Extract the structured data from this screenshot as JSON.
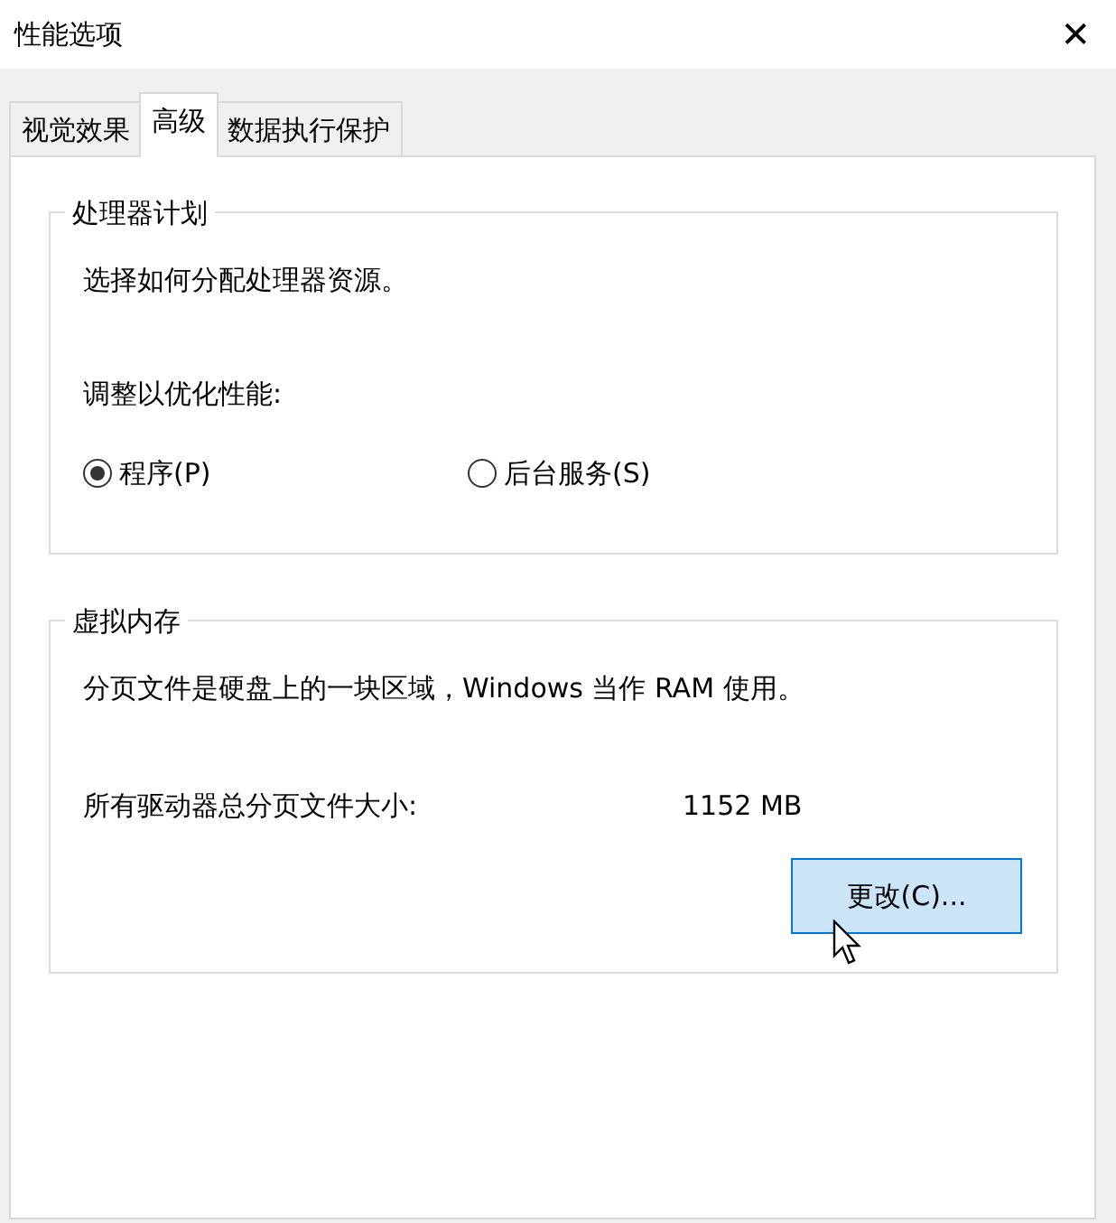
{
  "window": {
    "title": "性能选项",
    "close": "✕"
  },
  "tabs": [
    {
      "label": "视觉效果",
      "selected": false
    },
    {
      "label": "高级",
      "selected": true
    },
    {
      "label": "数据执行保护",
      "selected": false
    }
  ],
  "processor_group": {
    "legend": "处理器计划",
    "description": "选择如何分配处理器资源。",
    "prompt": "调整以优化性能:",
    "options": [
      {
        "label": "程序(P)",
        "selected": true
      },
      {
        "label": "后台服务(S)",
        "selected": false
      }
    ]
  },
  "memory_group": {
    "legend": "虚拟内存",
    "description": "分页文件是硬盘上的一块区域，Windows 当作 RAM 使用。",
    "size_label": "所有驱动器总分页文件大小:",
    "size_value": "1152 MB",
    "button": "更改(C)..."
  }
}
